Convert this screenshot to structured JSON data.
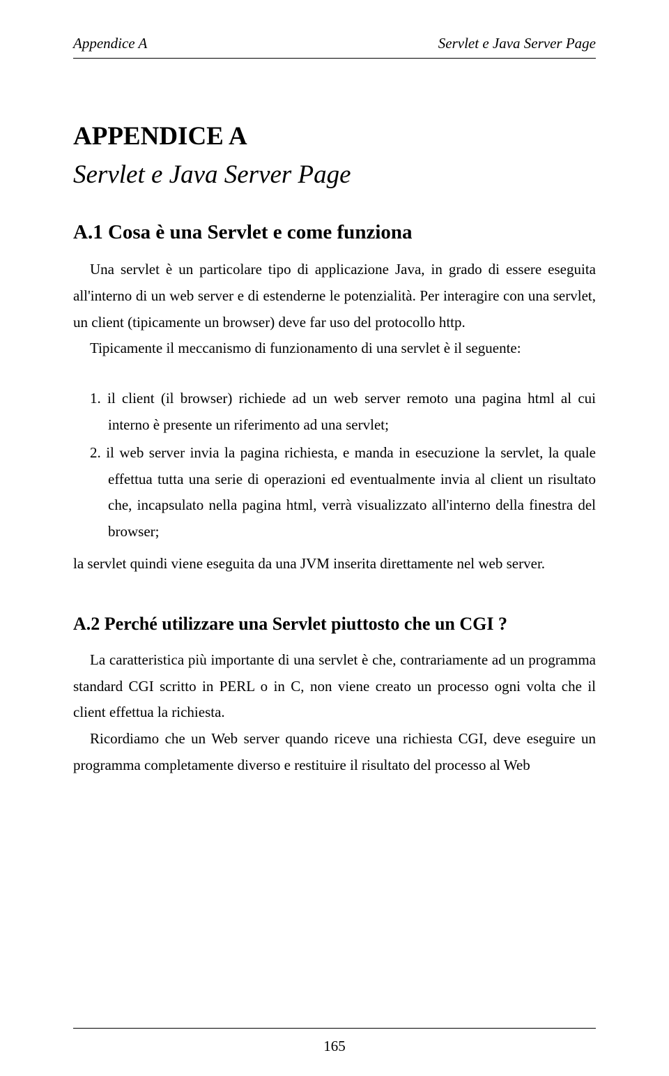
{
  "header": {
    "left": "Appendice A",
    "right": "Servlet e Java Server Page"
  },
  "title": {
    "line1": "APPENDICE A",
    "line2": "Servlet e Java Server Page"
  },
  "section1": {
    "heading": "A.1 Cosa è una Servlet e come funziona",
    "para1": "Una servlet è un particolare tipo di applicazione Java, in grado di essere eseguita all'interno di un web server e di estenderne le  potenzialità. Per interagire con una servlet, un client (tipicamente un browser) deve far uso del protocollo http.",
    "para2": "Tipicamente il meccanismo di funzionamento di una servlet è il seguente:",
    "list": [
      "1.  il client (il browser) richiede ad un web server remoto una pagina html al cui interno è presente un riferimento ad una servlet;",
      "2.  il web server invia la pagina richiesta, e manda in esecuzione la servlet, la quale effettua tutta una serie di operazioni ed eventualmente invia al client un risultato che, incapsulato  nella pagina html,  verrà visualizzato all'interno della finestra del browser;"
    ],
    "para3": "la servlet quindi viene eseguita da una JVM inserita direttamente nel web server."
  },
  "section2": {
    "heading": "A.2 Perché utilizzare una Servlet piuttosto che un CGI ?",
    "para1": "La caratteristica più importante di una servlet è che, contrariamente ad un programma standard CGI  scritto in PERL o in C,  non viene creato un processo ogni volta che il client effettua la richiesta.",
    "para2": "Ricordiamo che un Web server quando riceve una richiesta CGI, deve eseguire un programma completamente diverso e restituire il risultato del processo al Web"
  },
  "footer": {
    "page_number": "165"
  }
}
